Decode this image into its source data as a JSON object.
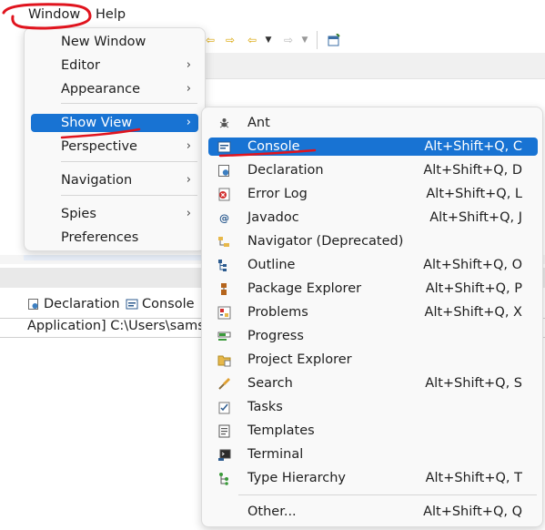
{
  "menubar": {
    "window_label": "Window",
    "help_label": "Help"
  },
  "window_menu": {
    "items": [
      {
        "label": "New Window",
        "submenu": false
      },
      {
        "label": "Editor",
        "submenu": true
      },
      {
        "label": "Appearance",
        "submenu": true
      },
      {
        "label": "Show View",
        "submenu": true,
        "highlighted": true
      },
      {
        "label": "Perspective",
        "submenu": true
      },
      {
        "label": "Navigation",
        "submenu": true
      },
      {
        "label": "Spies",
        "submenu": true
      },
      {
        "label": "Preferences",
        "submenu": false
      }
    ],
    "arrow": "›"
  },
  "show_view_menu": {
    "items": [
      {
        "label": "Ant",
        "shortcut": "",
        "icon": "ant-icon"
      },
      {
        "label": "Console",
        "shortcut": "Alt+Shift+Q, C",
        "icon": "console-icon",
        "highlighted": true
      },
      {
        "label": "Declaration",
        "shortcut": "Alt+Shift+Q, D",
        "icon": "declaration-icon"
      },
      {
        "label": "Error Log",
        "shortcut": "Alt+Shift+Q, L",
        "icon": "error-log-icon"
      },
      {
        "label": "Javadoc",
        "shortcut": "Alt+Shift+Q, J",
        "icon": "javadoc-icon"
      },
      {
        "label": "Navigator (Deprecated)",
        "shortcut": "",
        "icon": "navigator-icon"
      },
      {
        "label": "Outline",
        "shortcut": "Alt+Shift+Q, O",
        "icon": "outline-icon"
      },
      {
        "label": "Package Explorer",
        "shortcut": "Alt+Shift+Q, P",
        "icon": "package-explorer-icon"
      },
      {
        "label": "Problems",
        "shortcut": "Alt+Shift+Q, X",
        "icon": "problems-icon"
      },
      {
        "label": "Progress",
        "shortcut": "",
        "icon": "progress-icon"
      },
      {
        "label": "Project Explorer",
        "shortcut": "",
        "icon": "project-explorer-icon"
      },
      {
        "label": "Search",
        "shortcut": "Alt+Shift+Q, S",
        "icon": "search-icon"
      },
      {
        "label": "Tasks",
        "shortcut": "",
        "icon": "tasks-icon"
      },
      {
        "label": "Templates",
        "shortcut": "",
        "icon": "templates-icon"
      },
      {
        "label": "Terminal",
        "shortcut": "",
        "icon": "terminal-icon"
      },
      {
        "label": "Type Hierarchy",
        "shortcut": "Alt+Shift+Q, T",
        "icon": "type-hierarchy-icon"
      },
      {
        "label": "Other...",
        "shortcut": "Alt+Shift+Q, Q",
        "icon": ""
      }
    ]
  },
  "views": {
    "declaration_tab": "Declaration",
    "console_tab": "Console",
    "console_line": "Application] C:\\Users\\sams"
  },
  "colors": {
    "highlight": "#1873d3",
    "annotation": "#e0141e"
  }
}
